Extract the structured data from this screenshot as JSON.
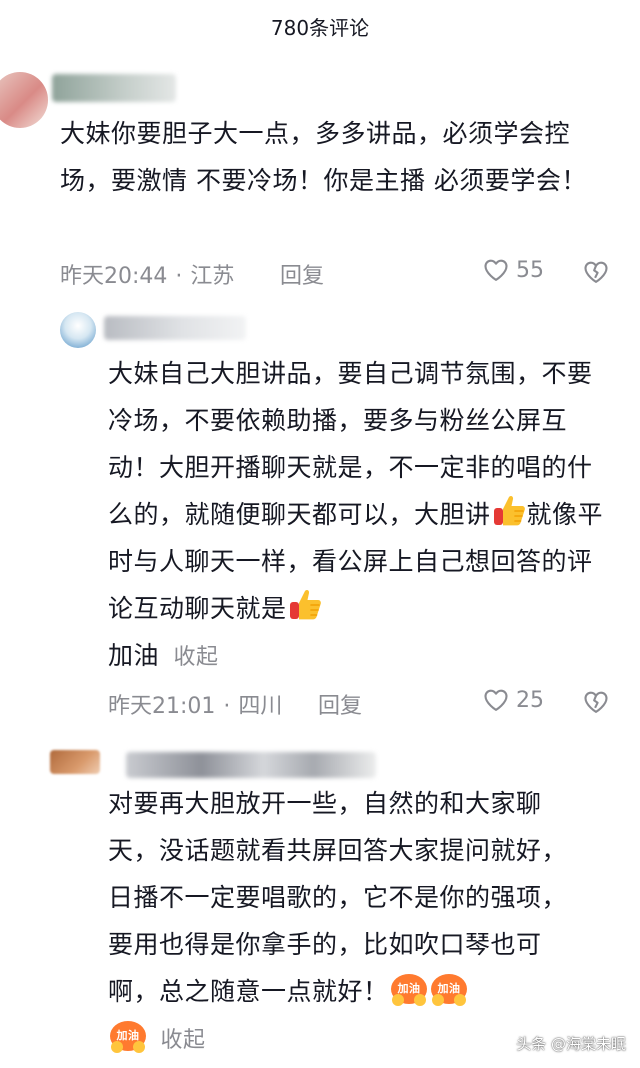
{
  "header": {
    "title": "780条评论"
  },
  "comments": [
    {
      "text": "大妹你要胆子大一点，多多讲品，必须学会控场，要激情  不要冷场！你是主播 必须要学会！",
      "time": "昨天20:44",
      "location": "江苏",
      "reply_label": "回复",
      "likes": "55"
    },
    {
      "text_part1": "大妹自己大胆讲品，要自己调节氛围，不要冷场，不要依赖助播，要多与粉丝公屏互动！大胆开播聊天就是，不一定非的唱的什么的，就随便聊天都可以，大胆讲",
      "text_part2": "就像平时与人聊天一样，看公屏上自己想回答的评论互动聊天就是",
      "text_part3": "加油",
      "collapse_label": "收起",
      "time": "昨天21:01",
      "location": "四川",
      "reply_label": "回复",
      "likes": "25"
    },
    {
      "text": "对要再大胆放开一些，自然的和大家聊天，没话题就看共屏回答大家提问就好，日播不一定要唱歌的，它不是你的强项，要用也得是你拿手的，比如吹口琴也可啊，总之随意一点就好！",
      "collapse_label": "收起"
    }
  ],
  "emoji": {
    "jiayou_text": "加油"
  },
  "icons": {
    "like": "heart-outline-icon",
    "dislike": "broken-heart-icon",
    "thumb": "thumbs-up-emoji",
    "cheer": "jiayou-emoji"
  },
  "watermark": {
    "platform": "头条",
    "account": "@海棠未眠"
  }
}
